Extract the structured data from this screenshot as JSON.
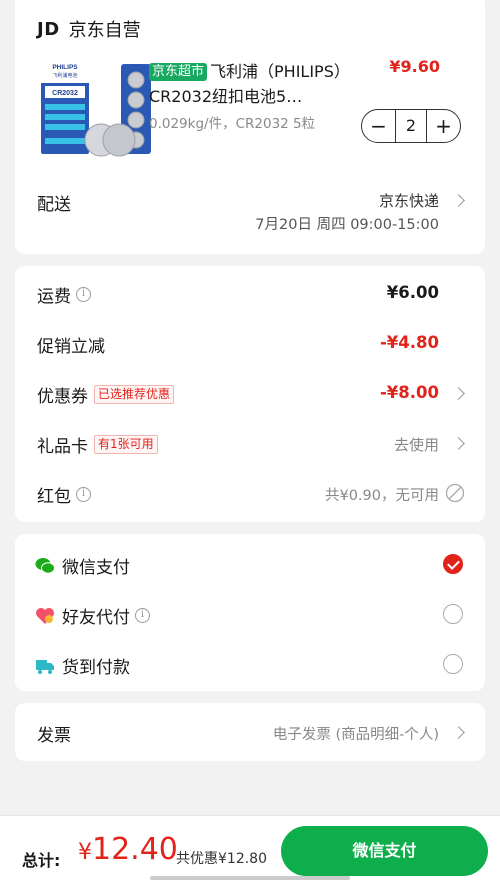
{
  "shop": {
    "logo": "JD",
    "name": "京东自营"
  },
  "product": {
    "tag": "京东超市",
    "title": "飞利浦（PHILIPS）CR2032纽扣电池5…",
    "spec": "0.029kg/件，CR2032 5粒",
    "price": "¥9.60",
    "quantity": "2",
    "image_brand": "PHILIPS",
    "image_sub": "飞利浦电池",
    "image_model": "CR2032"
  },
  "delivery": {
    "label": "配送",
    "method": "京东快递",
    "time": "7月20日 周四 09:00-15:00"
  },
  "fees": {
    "shipping": {
      "label": "运费",
      "value": "¥6.00"
    },
    "promo": {
      "label": "促销立减",
      "value": "-¥4.80"
    },
    "coupon": {
      "label": "优惠券",
      "tag": "已选推荐优惠",
      "value": "-¥8.00"
    },
    "giftcard": {
      "label": "礼品卡",
      "tag": "有1张可用",
      "value": "去使用"
    },
    "redpacket": {
      "label": "红包",
      "value": "共¥0.90，无可用"
    }
  },
  "payment": {
    "wechat": {
      "label": "微信支付",
      "selected": true
    },
    "friend": {
      "label": "好友代付",
      "selected": false
    },
    "cod": {
      "label": "货到付款",
      "selected": false
    }
  },
  "invoice": {
    "label": "发票",
    "value": "电子发票 (商品明细-个人)"
  },
  "footer": {
    "total_label": "总计:",
    "currency": "¥",
    "total": "12.40",
    "discount": "共优惠¥12.80",
    "pay_button": "微信支付"
  },
  "colors": {
    "accent_red": "#e2231a",
    "pay_green": "#0fae4d",
    "tag_green": "#18a960"
  }
}
